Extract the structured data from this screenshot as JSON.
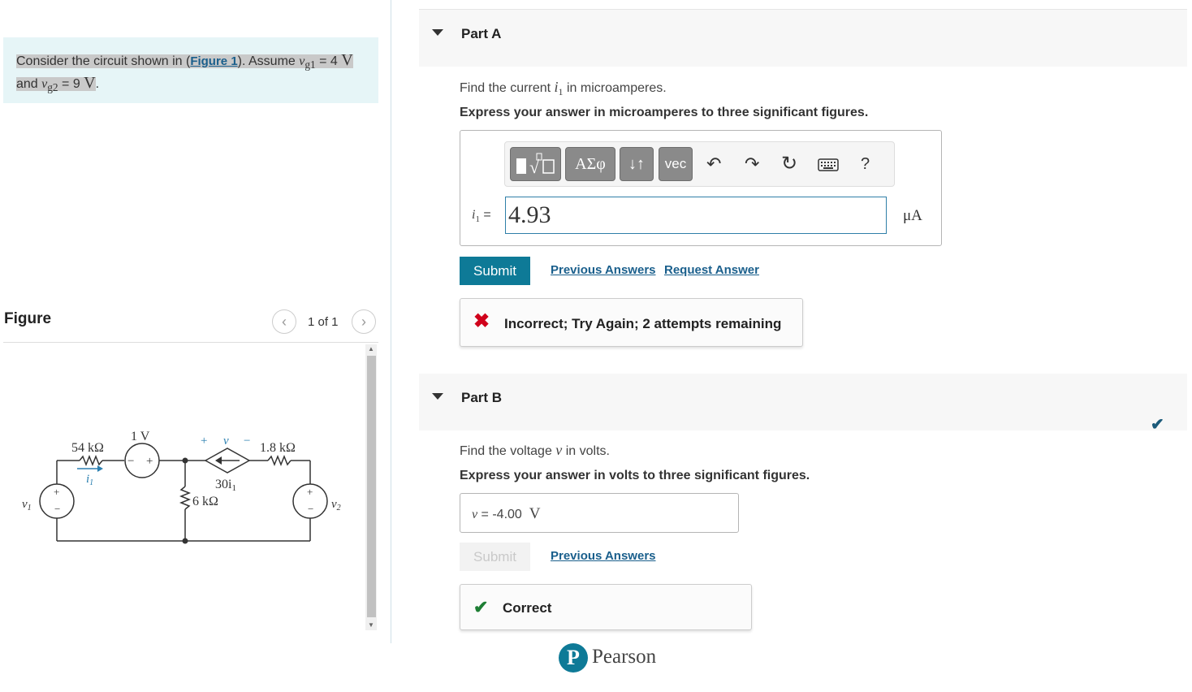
{
  "problem": {
    "line1_prefix": "Consider the circuit shown in (",
    "figure_link": "Figure 1",
    "line1_mid": "). Assume ",
    "vg1_var": "v",
    "vg1_sub": "g1",
    "vg1_eq": " = 4 ",
    "vg1_unit": "V",
    "line2_prefix": "and ",
    "vg2_var": "v",
    "vg2_sub": "g2",
    "vg2_eq": " = 9 ",
    "vg2_unit": "V",
    "period": "."
  },
  "figure": {
    "title": "Figure",
    "page_count": "1 of 1",
    "prev_icon": "chevron-left-icon",
    "next_icon": "chevron-right-icon",
    "labels": {
      "r1": "54 kΩ",
      "vs": "1 V",
      "i1": "i",
      "i1_sub": "1",
      "v_plus": "+",
      "v_var": "v",
      "v_minus": "−",
      "r2": "1.8 kΩ",
      "dep": "30i",
      "dep_sub": "1",
      "r3": "6 kΩ",
      "v1": "v",
      "v1_sub": "1",
      "v2": "v",
      "v2_sub": "2",
      "src_minus": "−",
      "src_plus": "+"
    }
  },
  "partA": {
    "title": "Part A",
    "question_prefix": "Find the current ",
    "question_var": "i",
    "question_sub": "1",
    "question_suffix": " in microamperes.",
    "instruction": "Express your answer in microamperes to three significant figures.",
    "toolbar": {
      "btn_greek": "ΑΣφ",
      "btn_arrows": "↓↑",
      "btn_vec": "vec",
      "help": "?",
      "icons": [
        "templates-icon",
        "undo-icon",
        "redo-icon",
        "reset-icon",
        "keyboard-icon",
        "help-icon"
      ]
    },
    "input_label_var": "i",
    "input_label_sub": "1",
    "input_label_eq": " =",
    "input_value": "4.93",
    "unit": "μA",
    "submit": "Submit",
    "previous_answers": "Previous Answers",
    "request_answer": "Request Answer",
    "feedback": "Incorrect; Try Again; 2 attempts remaining"
  },
  "partB": {
    "title": "Part B",
    "question_prefix": "Find the voltage ",
    "question_var": "v",
    "question_suffix": " in volts.",
    "instruction": "Express your answer in volts to three significant figures.",
    "answer_var": "v",
    "answer_eq": " = ",
    "answer_value": "-4.00",
    "answer_unit": "V",
    "submit": "Submit",
    "previous_answers": "Previous Answers",
    "feedback": "Correct"
  },
  "footer": {
    "brand": "Pearson",
    "brand_letter": "P"
  },
  "colors": {
    "accent": "#0e7a97",
    "incorrect": "#d0021b",
    "correct": "#1e7e34",
    "link": "#1a5f8c"
  }
}
